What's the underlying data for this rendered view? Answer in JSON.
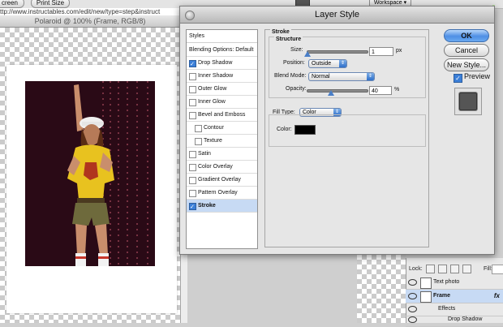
{
  "toolbar": {
    "btn1": "creen",
    "btn2": "Print Size",
    "workspace": "Workspace"
  },
  "url": "ttp://www.instructables.com/edit/new/type=step&instruct",
  "document": {
    "title": "Polaroid @ 100% (Frame, RGB/8)"
  },
  "dialog": {
    "title": "Layer Style",
    "styles_header": "Styles",
    "style_items": [
      {
        "label": "Blending Options: Default",
        "checkbox": false,
        "checked": false,
        "indent": false,
        "selected": false
      },
      {
        "label": "Drop Shadow",
        "checkbox": true,
        "checked": true,
        "indent": false,
        "selected": false
      },
      {
        "label": "Inner Shadow",
        "checkbox": true,
        "checked": false,
        "indent": false,
        "selected": false
      },
      {
        "label": "Outer Glow",
        "checkbox": true,
        "checked": false,
        "indent": false,
        "selected": false
      },
      {
        "label": "Inner Glow",
        "checkbox": true,
        "checked": false,
        "indent": false,
        "selected": false
      },
      {
        "label": "Bevel and Emboss",
        "checkbox": true,
        "checked": false,
        "indent": false,
        "selected": false
      },
      {
        "label": "Contour",
        "checkbox": true,
        "checked": false,
        "indent": true,
        "selected": false
      },
      {
        "label": "Texture",
        "checkbox": true,
        "checked": false,
        "indent": true,
        "selected": false
      },
      {
        "label": "Satin",
        "checkbox": true,
        "checked": false,
        "indent": false,
        "selected": false
      },
      {
        "label": "Color Overlay",
        "checkbox": true,
        "checked": false,
        "indent": false,
        "selected": false
      },
      {
        "label": "Gradient Overlay",
        "checkbox": true,
        "checked": false,
        "indent": false,
        "selected": false
      },
      {
        "label": "Pattern Overlay",
        "checkbox": true,
        "checked": false,
        "indent": false,
        "selected": false
      },
      {
        "label": "Stroke",
        "checkbox": true,
        "checked": true,
        "indent": false,
        "selected": true
      }
    ],
    "stroke": {
      "group_title": "Stroke",
      "structure_title": "Structure",
      "size_label": "Size:",
      "size_value": "1",
      "size_unit": "px",
      "size_level": 0.01,
      "position_label": "Position:",
      "position_value": "Outside",
      "blend_label": "Blend Mode:",
      "blend_value": "Normal",
      "opacity_label": "Opacity:",
      "opacity_value": "40",
      "opacity_unit": "%",
      "opacity_level": 0.4,
      "fill_type_label": "Fill Type:",
      "fill_type_value": "Color",
      "color_label": "Color:",
      "color_value": "#000000"
    },
    "buttons": {
      "ok": "OK",
      "cancel": "Cancel",
      "new_style": "New Style..."
    },
    "preview_label": "Preview",
    "preview_checked": true
  },
  "layers": {
    "lock_label": "Lock:",
    "fill_label": "Fill:",
    "rows": [
      {
        "name": "Text photo",
        "fx": ""
      },
      {
        "name": "Frame",
        "fx": "fx"
      },
      {
        "name": "Effects",
        "fx": ""
      },
      {
        "name": "Drop Shadow",
        "fx": ""
      }
    ]
  },
  "colors": {
    "accent": "#3b7fd8",
    "selection": "#c7daf4",
    "photo_bg": "#2a0a16",
    "shirt": "#e8c21f"
  }
}
